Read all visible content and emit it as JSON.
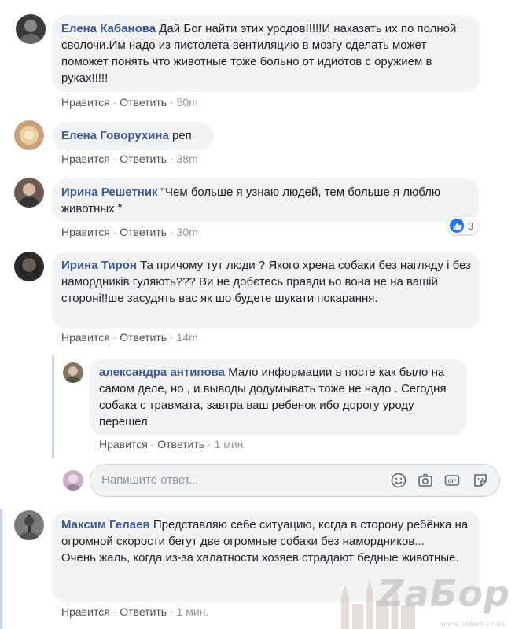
{
  "comments": [
    {
      "author": "Елена Кабанова",
      "text": "Дай Бог найти этих уродов!!!!!И наказать их по полной сволочи.Им надо из пистолета вентиляцию в мозгу сделать может поможет понять что животные тоже больно от идиотов с оружием в руках!!!!!",
      "like": "Нравится",
      "reply": "Ответить",
      "time": "50m",
      "avatar_color": "#3a3a3a"
    },
    {
      "author": "Елена Говорухина",
      "text": "реп",
      "like": "Нравится",
      "reply": "Ответить",
      "time": "38m",
      "avatar_color": "#c9a07a"
    },
    {
      "author": "Ирина Решетник",
      "text": "\"Чем больше я узнаю людей, тем больше я люблю животных \"",
      "like": "Нравится",
      "reply": "Ответить",
      "time": "30m",
      "avatar_color": "#6a5a50",
      "reactions": "3"
    },
    {
      "author": "Ирина Тирон",
      "text": "Та причому тут люди ? Якого хрена собаки без нагляду і без намордників гуляють??? Ви не добєтесь правди ьо вона не на вашій стороні!!ше засудять вас як шо будете шукати покарання.",
      "like": "Нравится",
      "reply": "Ответить",
      "time": "14m",
      "avatar_color": "#2a2a2a"
    },
    {
      "author": "александра антипова",
      "text": "Мало информации в посте как было на самом деле, но , и выводы додумывать тоже не надо . Сегодня собака с травмата, завтра ваш ребенок ибо дорогу уроду перешел.",
      "like": "Нравится",
      "reply": "Ответить",
      "time": "1 мин.",
      "avatar_color": "#8a7060"
    },
    {
      "author": "Максим Гелаев",
      "text": "Представляю себе ситуацию, когда в сторону ребёнка на огромной скорости бегут две огромные собаки без намордников...",
      "text2": "Очень жаль, когда из-за халатности хозяев страдают бедные животные.",
      "like": "Нравится",
      "reply": "Ответить",
      "time": "1 мин.",
      "avatar_color": "#7a7a7a"
    }
  ],
  "reply_input": {
    "placeholder": "Напишите ответ..."
  },
  "watermark": {
    "text": "ZaБор",
    "sub": "WWW.ZABOR.ZP.UA"
  },
  "colors": {
    "author": "#385898",
    "bubble": "#f2f3f5",
    "meta": "#90949c",
    "like_blue": "#1877f2"
  }
}
